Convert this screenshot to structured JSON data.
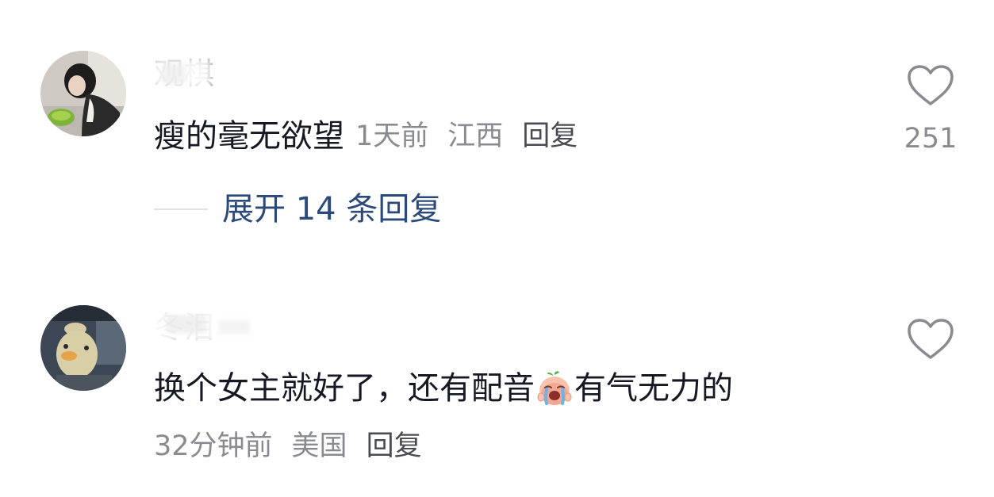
{
  "comments": [
    {
      "username": "观棋",
      "text": "瘦的毫无欲望",
      "time": "1天前",
      "location": "江西",
      "reply_label": "回复",
      "like_count": "251",
      "expand_replies_label": "展开 14 条回复",
      "avatar_icon": "avatar-photo-girl"
    },
    {
      "username": "冬泪",
      "text_before_emoji": "换个女主就好了，还有配音",
      "emoji_icon": "crying-face-emoji",
      "text_after_emoji": "有气无力的",
      "time": "32分钟前",
      "location": "美国",
      "reply_label": "回复",
      "avatar_icon": "avatar-photo-plush-toy"
    }
  ],
  "colors": {
    "text": "#161823",
    "meta": "#8a8b91",
    "link": "#2b4a7a",
    "heart_outline": "#8a8b91"
  }
}
